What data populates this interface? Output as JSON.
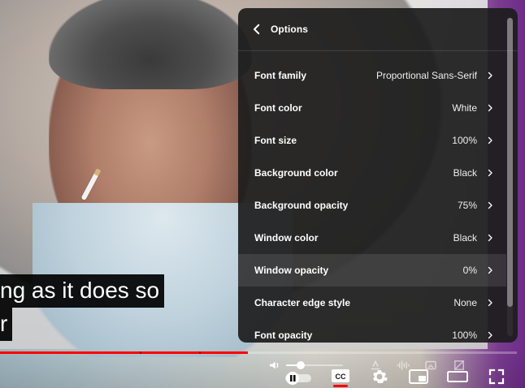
{
  "settings_panel": {
    "title": "Options",
    "items": [
      {
        "label": "Font family",
        "value": "Proportional Sans-Serif"
      },
      {
        "label": "Font color",
        "value": "White"
      },
      {
        "label": "Font size",
        "value": "100%"
      },
      {
        "label": "Background color",
        "value": "Black"
      },
      {
        "label": "Background opacity",
        "value": "75%"
      },
      {
        "label": "Window color",
        "value": "Black"
      },
      {
        "label": "Window opacity",
        "value": "0%"
      },
      {
        "label": "Character edge style",
        "value": "None"
      },
      {
        "label": "Font opacity",
        "value": "100%"
      }
    ],
    "highlighted_item": "Window opacity"
  },
  "subtitles": {
    "line1": "ng as it does so",
    "line2": "r"
  },
  "progress": {
    "played_fraction": 0.48,
    "buffered_fraction": 0.48,
    "chapters": [
      0.27,
      0.385
    ]
  },
  "controls": {
    "icons": [
      "volume-icon",
      "volume-slider",
      "autoplay-toggle",
      "captions-icon",
      "settings-gear-icon",
      "miniplayer-icon",
      "theater-mode-icon",
      "fullscreen-icon"
    ]
  },
  "colors": {
    "accent": "#ff0000",
    "panel_bg": "#1c1c1c",
    "text": "#ffffff"
  }
}
